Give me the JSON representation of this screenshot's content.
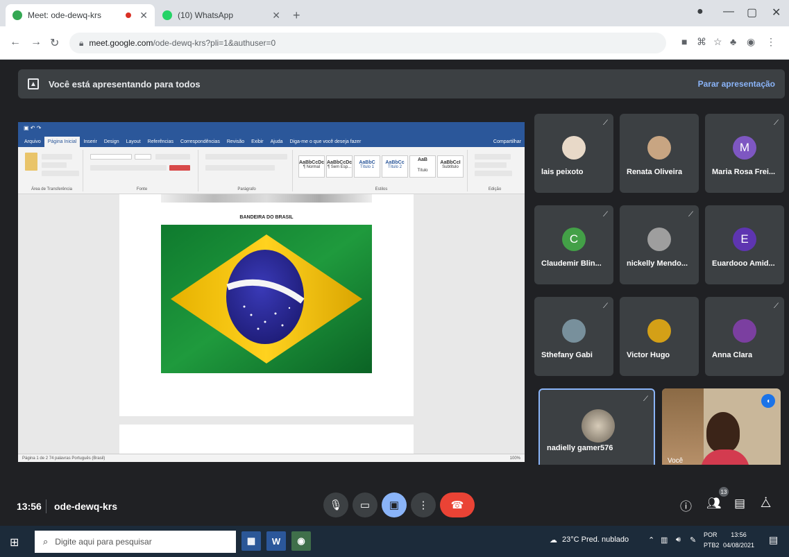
{
  "browser": {
    "tabs": [
      {
        "title": "Meet: ode-dewq-krs",
        "active": true
      },
      {
        "title": "(10) WhatsApp",
        "active": false
      }
    ],
    "url": {
      "host": "meet.google.com",
      "path": "/ode-dewq-krs?pli=1&authuser=0"
    }
  },
  "meet": {
    "banner": {
      "text": "Você está apresentando para todos",
      "stop_label": "Parar apresentação"
    },
    "presentation": {
      "doc_heading": "BANDEIRA DO BRASIL",
      "ribbon_tabs": [
        "Arquivo",
        "Página Inicial",
        "Inserir",
        "Design",
        "Layout",
        "Referências",
        "Correspondências",
        "Revisão",
        "Exibir",
        "Ajuda",
        "Diga-me o que você deseja fazer",
        "Compartilhar"
      ],
      "ribbon_groups": [
        "Área de Transferência",
        "Fonte",
        "Parágrafo",
        "Estilos",
        "Edição"
      ],
      "styles": [
        {
          "sample": "AaBbCcDc",
          "name": "¶ Normal"
        },
        {
          "sample": "AaBbCcDc",
          "name": "¶ Sem Esp..."
        },
        {
          "sample": "AaBbC",
          "name": "Título 1"
        },
        {
          "sample": "AaBbCc",
          "name": "Título 2"
        },
        {
          "sample": "AaB",
          "name": "Título"
        },
        {
          "sample": "AaBbCcI",
          "name": "Subtítulo"
        }
      ],
      "status": {
        "left": "Página 1 de 2   74 palavras   Português (Brasil)",
        "zoom": "100%"
      }
    },
    "participants": [
      {
        "name": "lais peixoto",
        "avatar": "photo",
        "color": "#e8d9c8",
        "initial": ""
      },
      {
        "name": "Renata Oliveira",
        "avatar": "photo",
        "color": "#c8a582",
        "initial": ""
      },
      {
        "name": "Maria Rosa Frei...",
        "avatar": "letter",
        "color": "#7e57c2",
        "initial": "M"
      },
      {
        "name": "Claudemir Blin...",
        "avatar": "letter",
        "color": "#43a047",
        "initial": "C"
      },
      {
        "name": "nickelly Mendo...",
        "avatar": "photo",
        "color": "#9e9e9e",
        "initial": ""
      },
      {
        "name": "Euardooo Amid...",
        "avatar": "letter",
        "color": "#5e35b1",
        "initial": "E"
      },
      {
        "name": "Sthefany Gabi",
        "avatar": "photo",
        "color": "#78909c",
        "initial": ""
      },
      {
        "name": "Victor Hugo",
        "avatar": "photo",
        "color": "#d4a017",
        "initial": ""
      },
      {
        "name": "Anna Clara",
        "avatar": "photo",
        "color": "#7b3fa0",
        "initial": ""
      }
    ],
    "self_tile": {
      "name": "nadielly gamer576"
    },
    "camera_tile": {
      "name": "Você"
    },
    "bottom": {
      "time": "13:56",
      "code": "ode-dewq-krs",
      "participant_count": "13"
    }
  },
  "taskbar": {
    "search_placeholder": "Digite aqui para pesquisar",
    "weather": "23°C  Pred. nublado",
    "lang_top": "POR",
    "lang_bottom": "PTB2",
    "time": "13:56",
    "date": "04/08/2021"
  }
}
